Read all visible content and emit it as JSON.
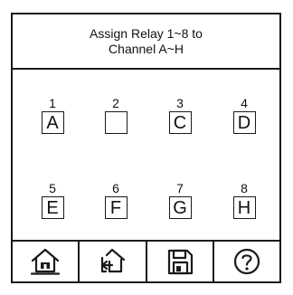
{
  "header": {
    "line1": "Assign Relay 1~8 to",
    "line2": "Channel A~H"
  },
  "relays": [
    {
      "number": "1",
      "channel": "A"
    },
    {
      "number": "2",
      "channel": ""
    },
    {
      "number": "3",
      "channel": "C"
    },
    {
      "number": "4",
      "channel": "D"
    },
    {
      "number": "5",
      "channel": "E"
    },
    {
      "number": "6",
      "channel": "F"
    },
    {
      "number": "7",
      "channel": "G"
    },
    {
      "number": "8",
      "channel": "H"
    }
  ],
  "toolbar": {
    "buttons": [
      {
        "icon": "home-icon"
      },
      {
        "icon": "back-icon"
      },
      {
        "icon": "save-icon"
      },
      {
        "icon": "help-icon"
      }
    ]
  }
}
